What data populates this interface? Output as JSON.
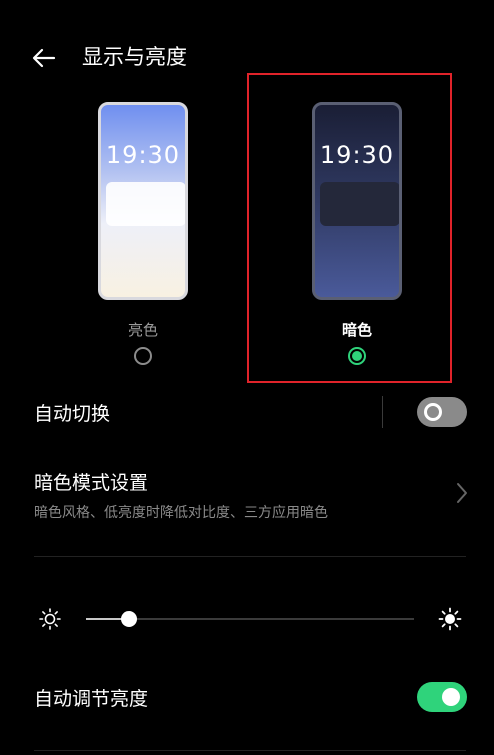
{
  "header": {
    "title": "显示与亮度"
  },
  "themes": {
    "light": {
      "time": "19:30",
      "label": "亮色",
      "selected": false
    },
    "dark": {
      "time": "19:30",
      "label": "暗色",
      "selected": true
    }
  },
  "auto_switch": {
    "label": "自动切换",
    "enabled": false
  },
  "dark_mode_settings": {
    "label": "暗色模式设置",
    "description": "暗色风格、低亮度时降低对比度、三方应用暗色"
  },
  "brightness": {
    "level": 0.13
  },
  "auto_brightness": {
    "label": "自动调节亮度",
    "enabled": true
  },
  "colors": {
    "accent": "#2fd37b",
    "highlight": "#e0232a"
  }
}
